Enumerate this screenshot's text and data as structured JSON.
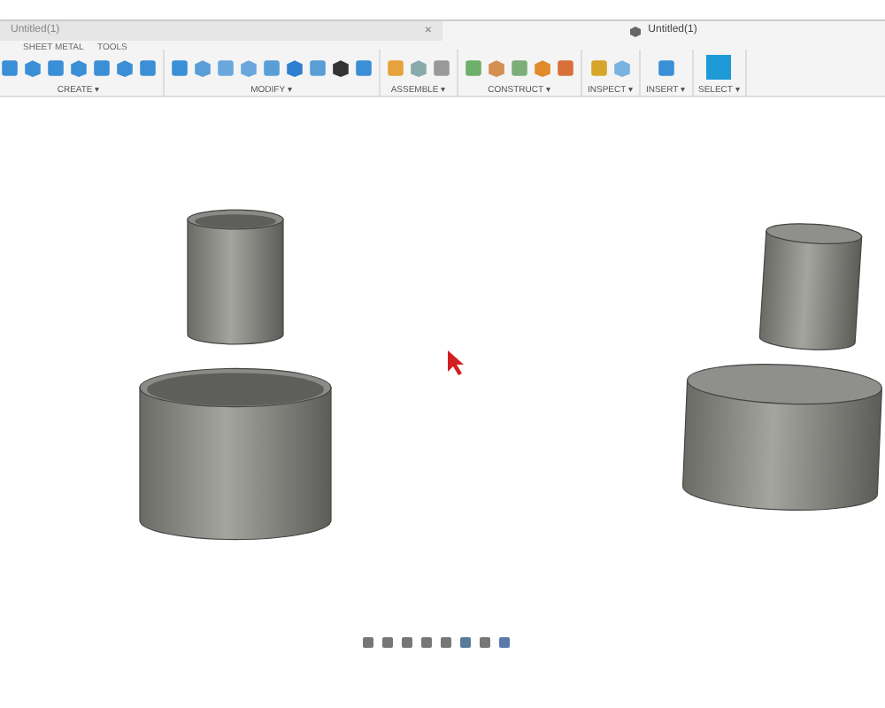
{
  "tabs": [
    {
      "title": "Untitled(1)",
      "selected": false,
      "close": "×"
    },
    {
      "title": "Untitled(1)",
      "selected": true
    }
  ],
  "toolbar": {
    "tabs": [
      {
        "label": "SHEET METAL"
      },
      {
        "label": "TOOLS"
      }
    ],
    "groups": [
      {
        "label": "CREATE",
        "caret": "▾"
      },
      {
        "label": "MODIFY",
        "caret": "▾"
      },
      {
        "label": "ASSEMBLE",
        "caret": "▾"
      },
      {
        "label": "CONSTRUCT",
        "caret": "▾"
      },
      {
        "label": "INSPECT",
        "caret": "▾"
      },
      {
        "label": "INSERT",
        "caret": "▾"
      },
      {
        "label": "SELECT",
        "caret": "▾"
      }
    ]
  },
  "viewport": {
    "objects": [
      {
        "kind": "hollow"
      },
      {
        "kind": "hollow"
      },
      {
        "kind": "solid"
      },
      {
        "kind": "solid"
      }
    ]
  }
}
